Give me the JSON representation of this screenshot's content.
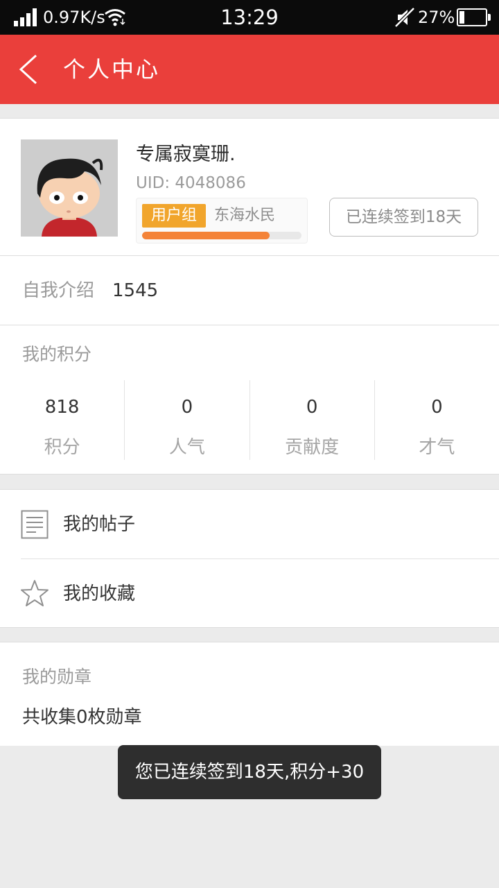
{
  "status_bar": {
    "net_speed": "0.97K/s",
    "time": "13:29",
    "battery_text": "27%",
    "battery_level": 0.27
  },
  "app_bar": {
    "title": "个人中心",
    "color": "#ea3f3b"
  },
  "profile": {
    "nickname": "专属寂寞珊.",
    "uid": "UID: 4048086",
    "group_badge": "用户组",
    "group_name": "东海水民",
    "level_progress": 0.8,
    "checkin_button": "已连续签到18天"
  },
  "intro": {
    "label": "自我介绍",
    "value": "1545"
  },
  "points": {
    "title": "我的积分",
    "stats": [
      {
        "value": "818",
        "label": "积分"
      },
      {
        "value": "0",
        "label": "人气"
      },
      {
        "value": "0",
        "label": "贡献度"
      },
      {
        "value": "0",
        "label": "才气"
      }
    ]
  },
  "menu": {
    "items": [
      {
        "label": "我的帖子",
        "icon": "document-icon"
      },
      {
        "label": "我的收藏",
        "icon": "star-icon"
      }
    ]
  },
  "medals": {
    "title": "我的勋章",
    "summary": "共收集0枚勋章"
  },
  "toast": {
    "message": "您已连续签到18天,积分+30"
  }
}
